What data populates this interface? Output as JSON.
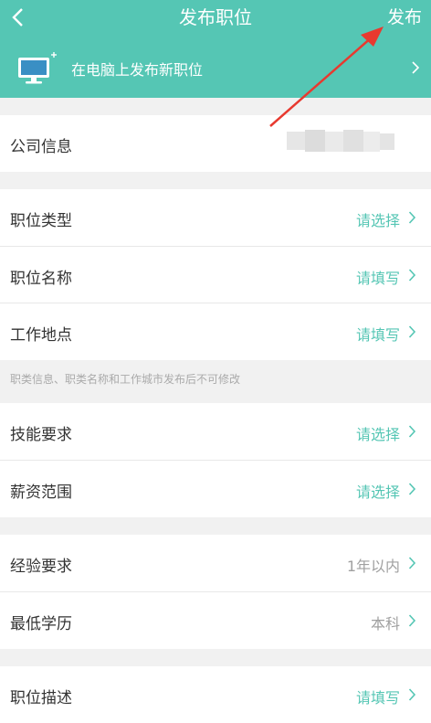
{
  "nav": {
    "title": "发布职位",
    "publish_label": "发布"
  },
  "banner": {
    "text": "在电脑上发布新职位",
    "icon": "monitor-icon"
  },
  "company": {
    "label": "公司信息"
  },
  "job_type": {
    "label": "职位类型",
    "value": "请选择"
  },
  "job_name": {
    "label": "职位名称",
    "value": "请填写"
  },
  "location": {
    "label": "工作地点",
    "value": "请填写"
  },
  "note": "职类信息、职类名称和工作城市发布后不可修改",
  "skills": {
    "label": "技能要求",
    "value": "请选择"
  },
  "salary": {
    "label": "薪资范围",
    "value": "请选择"
  },
  "experience": {
    "label": "经验要求",
    "value": "1年以内"
  },
  "education": {
    "label": "最低学历",
    "value": "本科"
  },
  "description": {
    "label": "职位描述",
    "value": "请填写"
  },
  "colors": {
    "accent": "#55c6b4",
    "background": "#f1f1f1",
    "arrow": "#e8392f"
  }
}
